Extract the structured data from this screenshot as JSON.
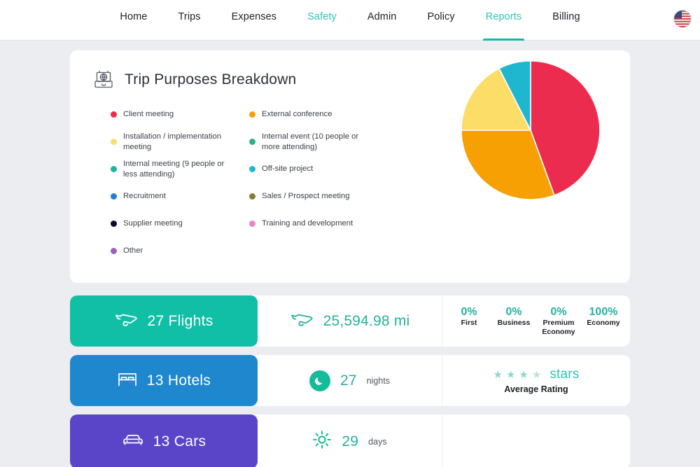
{
  "nav": {
    "items": [
      {
        "label": "Home",
        "state": "default"
      },
      {
        "label": "Trips",
        "state": "default"
      },
      {
        "label": "Expenses",
        "state": "default"
      },
      {
        "label": "Safety",
        "state": "accent"
      },
      {
        "label": "Admin",
        "state": "default"
      },
      {
        "label": "Policy",
        "state": "default"
      },
      {
        "label": "Reports",
        "state": "active"
      },
      {
        "label": "Billing",
        "state": "default"
      }
    ],
    "flag_icon": "us-flag-icon",
    "accent_color": "#2ec4b6"
  },
  "card": {
    "icon": "suitcase-globe-icon",
    "title": "Trip Purposes Breakdown"
  },
  "chart_data": {
    "type": "pie",
    "title": "Trip Purposes Breakdown",
    "legend_position": "left",
    "categories": [
      "Client meeting",
      "External conference",
      "Installation / implementation meeting",
      "Internal event (10 people or more attending)",
      "Internal meeting (9 people or less attending)",
      "Off-site project",
      "Recruitment",
      "Sales / Prospect meeting",
      "Supplier meeting",
      "Training and development",
      "Other"
    ],
    "colors": [
      "#ec2c4f",
      "#f6a004",
      "#fbdd68",
      "#2eb086",
      "#14b8a0",
      "#1fb6d0",
      "#1f7fd0",
      "#8a7a32",
      "#0d0b2b",
      "#e787c6",
      "#9a63b5"
    ],
    "values": [
      44.4,
      30.6,
      17.5,
      0,
      0,
      7.5,
      0,
      0,
      0,
      0,
      0
    ],
    "slices": [
      {
        "label": "Client meeting",
        "color": "#ec2c4f",
        "percent": 44.4,
        "start_deg": 0,
        "end_deg": 160
      },
      {
        "label": "External conference",
        "color": "#f6a004",
        "percent": 30.6,
        "start_deg": 160,
        "end_deg": 270
      },
      {
        "label": "Installation / implementation meeting",
        "color": "#fbdd68",
        "percent": 17.5,
        "start_deg": 270,
        "end_deg": 333
      },
      {
        "label": "Off-site project",
        "color": "#1fb6d0",
        "percent": 7.5,
        "start_deg": 333,
        "end_deg": 360
      }
    ]
  },
  "legend": [
    {
      "label": "Client meeting",
      "color": "#ec2c4f"
    },
    {
      "label": "External conference",
      "color": "#f6a004"
    },
    {
      "label": "Installation / implementation meeting",
      "color": "#fbdd68"
    },
    {
      "label": "Internal event (10 people or more attending)",
      "color": "#2eb086"
    },
    {
      "label": "Internal meeting (9 people or less attending)",
      "color": "#14b8a0"
    },
    {
      "label": "Off-site project",
      "color": "#1fb6d0"
    },
    {
      "label": "Recruitment",
      "color": "#1f7fd0"
    },
    {
      "label": "Sales / Prospect meeting",
      "color": "#8a7a32"
    },
    {
      "label": "Supplier meeting",
      "color": "#0d0b2b"
    },
    {
      "label": "Training and development",
      "color": "#e787c6"
    },
    {
      "label": "Other",
      "color": "#9a63b5"
    }
  ],
  "stats": {
    "flights": {
      "head_label": "27 Flights",
      "head_color": "#11bfa6",
      "head_icon": "airplane-icon",
      "distance_value": "25,594.98 mi",
      "distance_icon": "airplane-icon",
      "cabins": [
        {
          "pct": "0%",
          "label": "First"
        },
        {
          "pct": "0%",
          "label": "Business"
        },
        {
          "pct": "0%",
          "label": "Premium Economy"
        },
        {
          "pct": "100%",
          "label": "Economy"
        }
      ]
    },
    "hotels": {
      "head_label": "13 Hotels",
      "head_color": "#1e87cd",
      "head_icon": "bed-icon",
      "nights_value": "27",
      "nights_unit": "nights",
      "nights_icon": "moon-icon",
      "stars_count": 4,
      "stars_word": "stars",
      "rating_label": "Average Rating"
    },
    "cars": {
      "head_label": "13 Cars",
      "head_color": "#5a45c8",
      "head_icon": "car-icon",
      "days_value": "29",
      "days_unit": "days",
      "days_icon": "sun-icon"
    }
  }
}
